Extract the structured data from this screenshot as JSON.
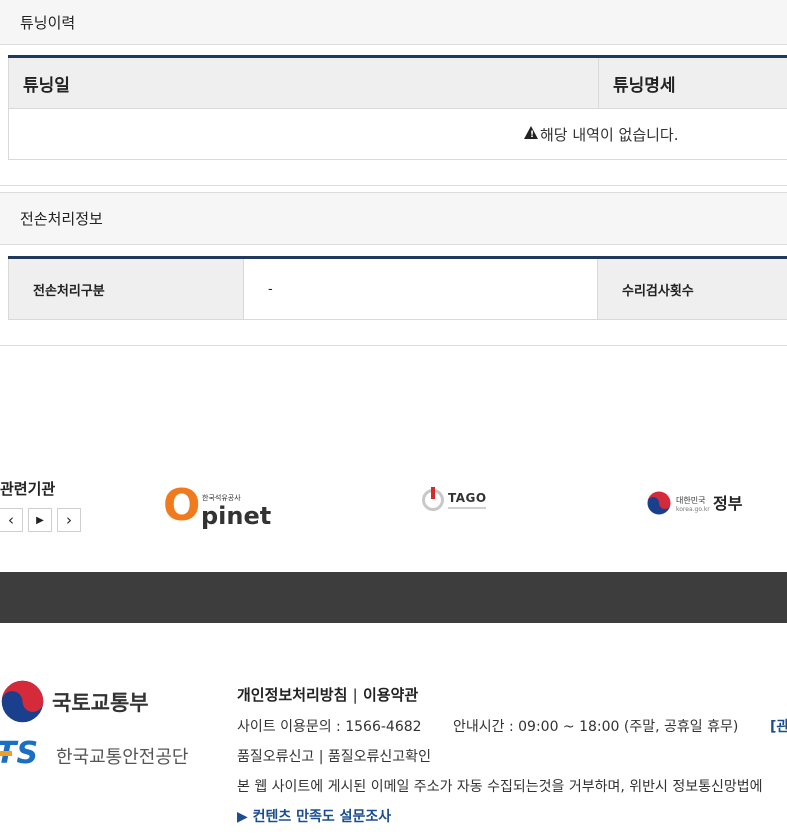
{
  "tuning_history": {
    "title": "튜닝이력",
    "columns": [
      "튜닝일",
      "튜닝명세"
    ],
    "empty_message": "해당 내역이 없습니다."
  },
  "transfer_info": {
    "title": "전손처리정보",
    "rows": [
      {
        "label": "전손처리구분",
        "value": "-",
        "label2": "수리검사횟수"
      }
    ]
  },
  "related": {
    "title": "관련기관",
    "prev_label": "‹",
    "play_label": "▶",
    "next_label": "›",
    "logos": {
      "opinet": {
        "small": "한국석유공사",
        "big_o": "O",
        "rest": "pinet"
      },
      "tago": {
        "name": "TAGO"
      },
      "gov": {
        "small": "대한민국",
        "big": "정부",
        "url": "korea.go.kr"
      }
    }
  },
  "footer": {
    "molit": "국토교통부",
    "kotsa_mark": "TS",
    "kotsa": "한국교통안전공단",
    "privacy": "개인정보처리방침",
    "sep": "|",
    "terms": "이용약관",
    "contact": "사이트 이용문의 : 1566-4682",
    "hours": "안내시간 : 09:00 ~ 18:00 (주말, 공휴일 휴무)",
    "right_link": "[관",
    "quality_report": "품질오류신고",
    "quality_check": "품질오류신고확인",
    "notice": "본 웹 사이트에 게시된 이메일 주소가 자동 수집되는것을 거부하며, 위반시 정보통신망법에",
    "survey": "▶ 컨텐츠 만족도 설문조사"
  },
  "colors": {
    "navy": "#1f3a5c",
    "dark_band": "#3d3d3d",
    "accent_orange": "#f07a1e"
  }
}
